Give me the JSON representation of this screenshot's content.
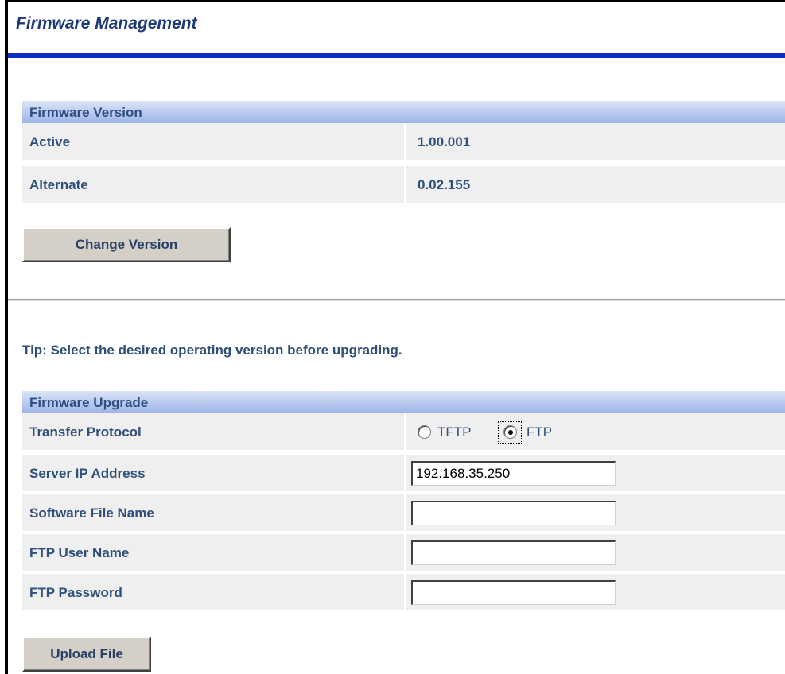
{
  "page": {
    "title": "Firmware Management"
  },
  "firmware_version": {
    "header": "Firmware Version",
    "rows": [
      {
        "label": "Active",
        "value": "1.00.001"
      },
      {
        "label": "Alternate",
        "value": "0.02.155"
      }
    ],
    "change_button": "Change Version"
  },
  "tip": "Tip: Select the desired operating version before upgrading.",
  "firmware_upgrade": {
    "header": "Firmware Upgrade",
    "transfer_protocol": {
      "label": "Transfer Protocol",
      "options": [
        "TFTP",
        "FTP"
      ],
      "selected": "FTP"
    },
    "server_ip": {
      "label": "Server IP Address",
      "value": "192.168.35.250"
    },
    "software_file": {
      "label": "Software File Name",
      "value": ""
    },
    "ftp_user": {
      "label": "FTP User Name",
      "value": ""
    },
    "ftp_password": {
      "label": "FTP Password",
      "value": ""
    },
    "upload_button": "Upload File"
  }
}
